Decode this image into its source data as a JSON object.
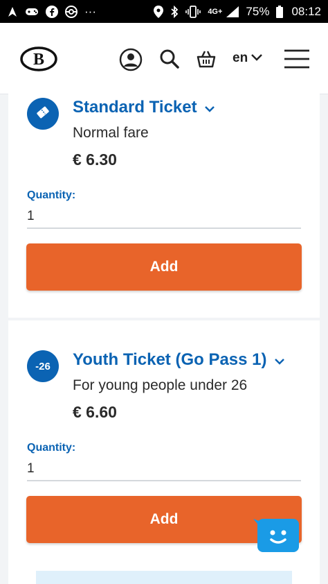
{
  "status_bar": {
    "dots": "···",
    "network": "4G+",
    "battery": "75%",
    "time": "08:12"
  },
  "header": {
    "logo_text": "B",
    "language": "en"
  },
  "tickets": [
    {
      "badge": "",
      "title": "Standard Ticket",
      "subtitle": "Normal fare",
      "price": "€ 6.30",
      "quantity_label": "Quantity:",
      "quantity": "1",
      "add_label": "Add"
    },
    {
      "badge": "-26",
      "title": "Youth Ticket (Go Pass 1)",
      "subtitle": "For young people under 26",
      "price": "€ 6.60",
      "quantity_label": "Quantity:",
      "quantity": "1",
      "add_label": "Add"
    }
  ],
  "colors": {
    "brand_blue": "#0b63b3",
    "add_orange": "#e8642a",
    "chat_blue": "#1a9be6"
  }
}
